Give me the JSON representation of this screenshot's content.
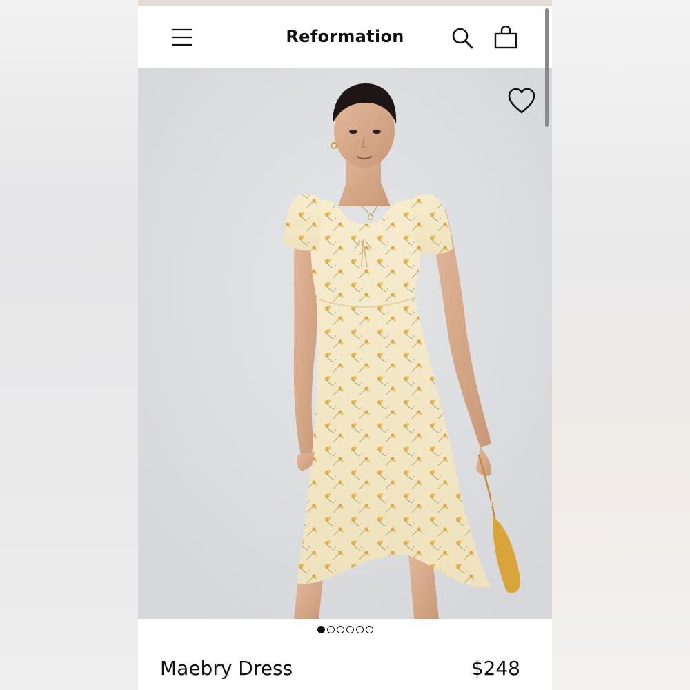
{
  "header": {
    "brand": "Reformation",
    "menu_icon": "hamburger-menu-icon",
    "search_icon": "search-icon",
    "bag_icon": "shopping-bag-icon"
  },
  "hero": {
    "image_subject": "model wearing cream floral dress",
    "favorite_icon": "heart-outline-icon"
  },
  "carousel": {
    "total": 6,
    "active_index": 0
  },
  "product": {
    "name": "Maebry Dress",
    "price": "$248"
  },
  "colors": {
    "text": "#111111",
    "background": "#ffffff",
    "dress": "#f3e9c8",
    "flowers": "#d9a53a"
  }
}
